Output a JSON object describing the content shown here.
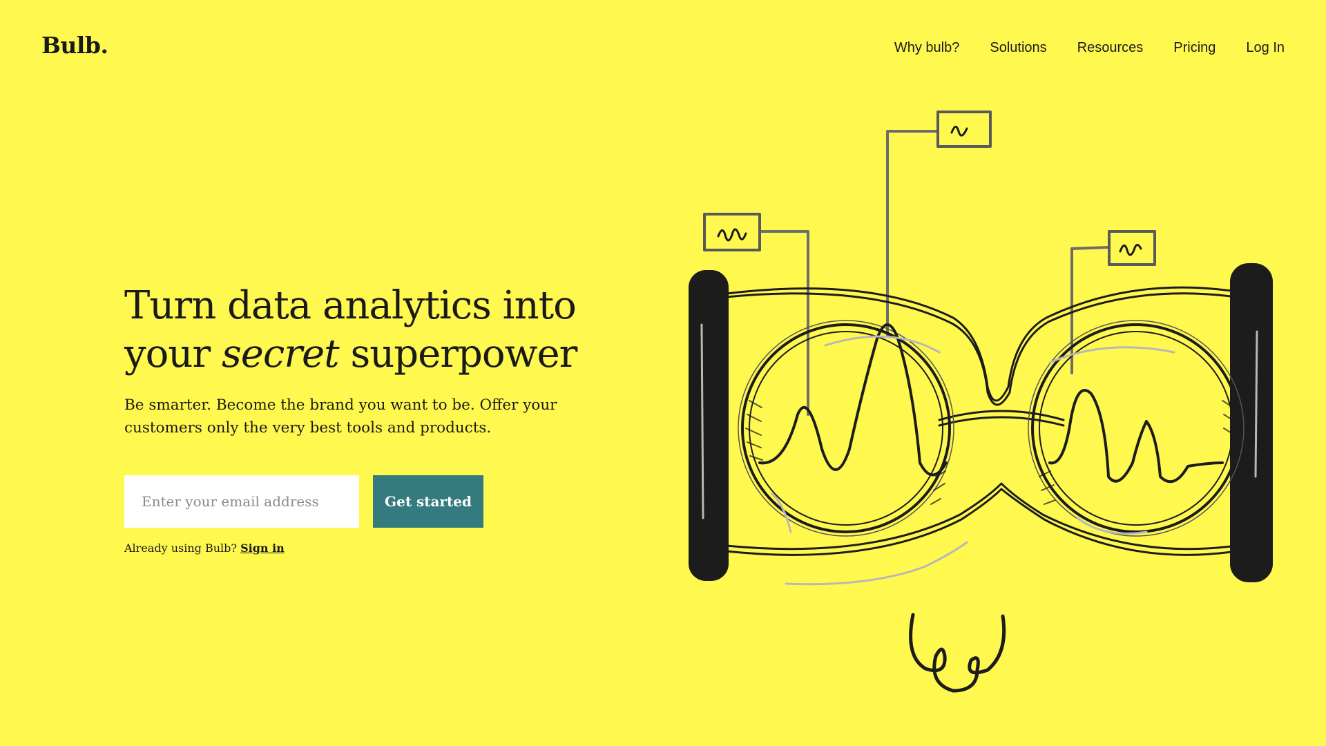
{
  "header": {
    "logo": "Bulb.",
    "nav": [
      {
        "label": "Why bulb?"
      },
      {
        "label": "Solutions"
      },
      {
        "label": "Resources"
      },
      {
        "label": "Pricing"
      },
      {
        "label": "Log In"
      }
    ]
  },
  "hero": {
    "title_line1": "Turn data analytics into",
    "title_your": "your",
    "title_secret": "secret",
    "title_superpower": "superpower",
    "subtitle": "Be smarter. Become the brand you want to be. Offer your customers only the very best tools and products.",
    "email_placeholder": "Enter your email address",
    "cta_label": "Get started",
    "already_text": "Already using Bulb?",
    "sign_in_label": "Sign in"
  },
  "colors": {
    "background": "#fff84f",
    "accent": "#347b80",
    "ink": "#1a1a1a"
  }
}
